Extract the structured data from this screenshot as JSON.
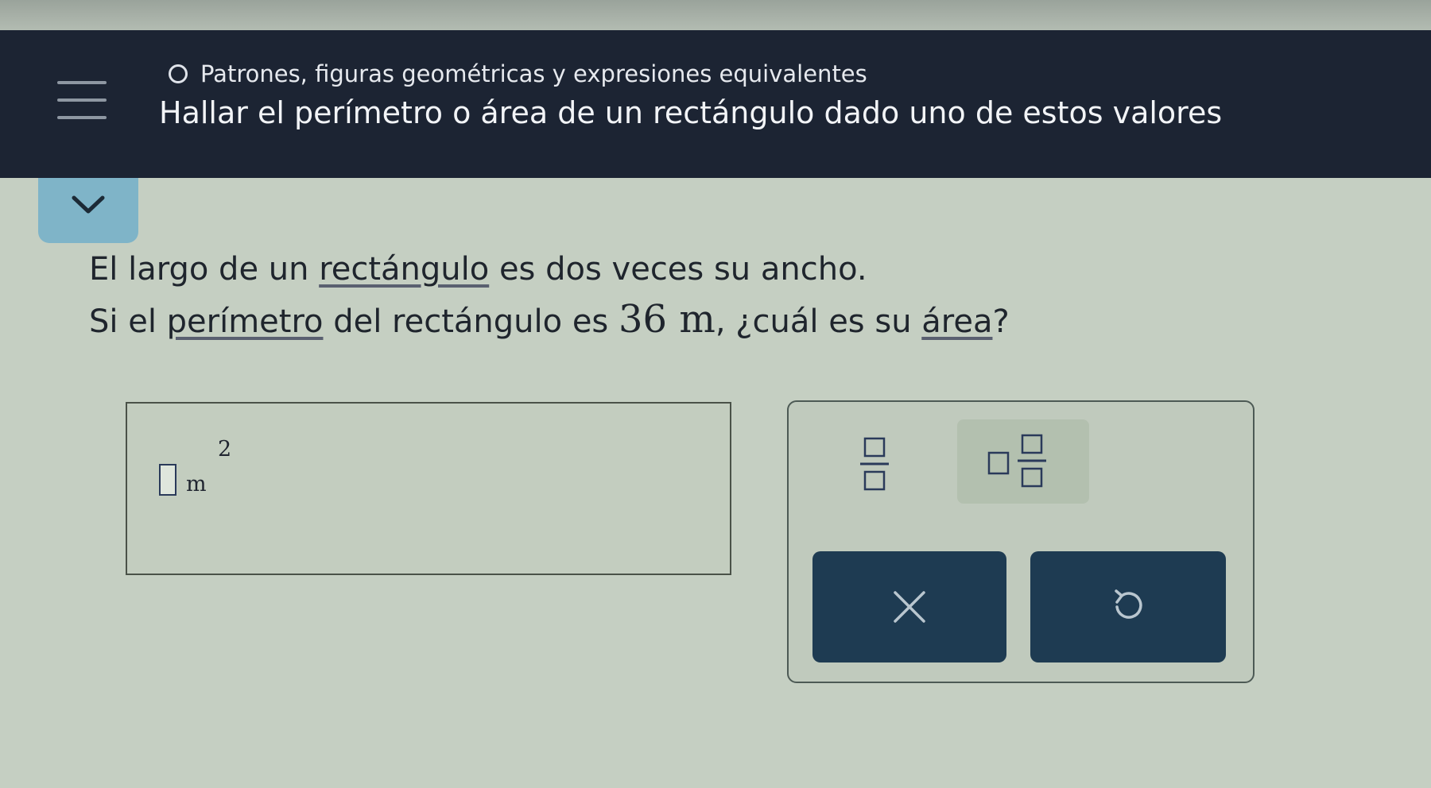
{
  "header": {
    "topic": "Patrones, figuras geométricas y expresiones equivalentes",
    "title": "Hallar el perímetro o área de un rectángulo dado uno de estos valores"
  },
  "question": {
    "line1_pre": "El largo de un ",
    "line1_link": "rectángulo",
    "line1_post": " es dos veces su ancho.",
    "line2_pre": "Si el ",
    "line2_link1": "perímetro",
    "line2_mid": " del rectángulo es ",
    "line2_value": "36 m",
    "line2_mid2": ", ¿cuál es su ",
    "line2_link2": "área",
    "line2_post": "?"
  },
  "answer": {
    "value": "",
    "unit": "m",
    "exponent": "2"
  },
  "keypad": {
    "keys": [
      "fraction",
      "mixed-number",
      "clear",
      "undo"
    ]
  },
  "icons": [
    "menu-icon",
    "radio-circle-icon",
    "chevron-down-icon",
    "fraction-icon",
    "mixed-number-icon",
    "x-icon",
    "undo-icon"
  ],
  "colors": {
    "header_bg": "#1c2433",
    "accent_tab": "#7fb4c8",
    "button_bg": "#1e3b52"
  }
}
